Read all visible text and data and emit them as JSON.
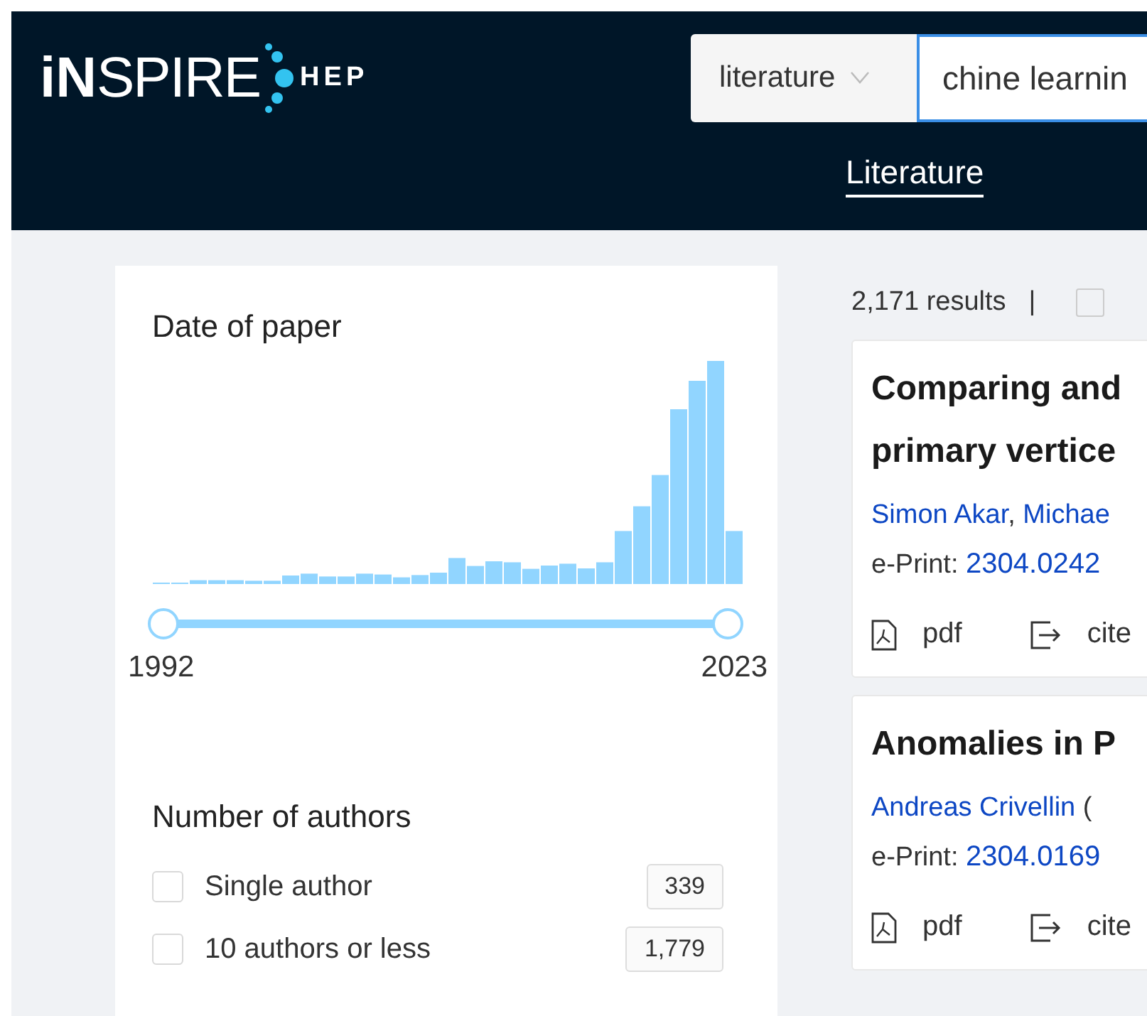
{
  "header": {
    "logo": {
      "bold": "iN",
      "light": "SPIRE",
      "suffix": "HEP"
    },
    "search": {
      "collection": "literature",
      "value": "chine learnin"
    },
    "nav": [
      {
        "label": "Literature",
        "selected": true
      }
    ]
  },
  "sidebar": {
    "date_facet": {
      "title": "Date of paper",
      "slider": {
        "thumbs": [
          {
            "level": 0
          },
          {
            "level": 1
          }
        ]
      },
      "min_label": "1992",
      "max_label": "2023"
    },
    "authors_facet": {
      "title": "Number of authors",
      "options": [
        {
          "label": "Single author",
          "count": "339",
          "checked": false
        },
        {
          "label": "10 authors or less",
          "count": "1,779",
          "checked": false
        }
      ]
    }
  },
  "results": {
    "count": "2,171 results",
    "separator": "|",
    "select_all": {
      "checked": false
    },
    "items": [
      {
        "title_lines": [
          "Comparing and",
          "primary vertice"
        ],
        "authors": [
          {
            "name": "Simon Akar",
            "separator": ","
          },
          {
            "name": "Michae"
          }
        ],
        "eprint_label": "e-Print:",
        "eprint": "2304.0242",
        "actions": [
          {
            "kind": "pdf",
            "label": "pdf"
          },
          {
            "kind": "cite",
            "label": "cite"
          }
        ]
      },
      {
        "title_lines": [
          "Anomalies in P"
        ],
        "authors": [
          {
            "name": "Andreas Crivellin"
          }
        ],
        "author_note": "(",
        "eprint_label": "e-Print:",
        "eprint": "2304.0169",
        "actions": [
          {
            "kind": "pdf",
            "label": "pdf"
          },
          {
            "kind": "cite",
            "label": "cite"
          }
        ]
      }
    ]
  }
}
